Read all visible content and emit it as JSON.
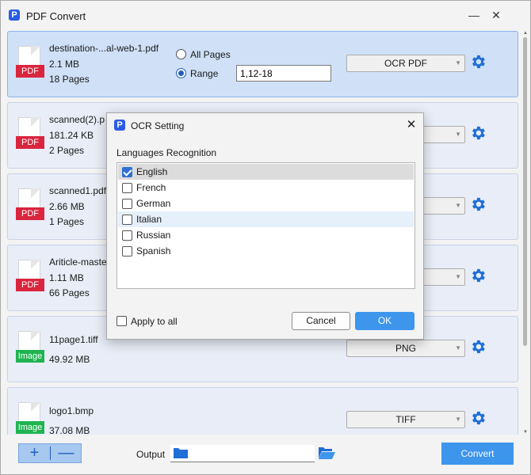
{
  "app": {
    "title": "PDF Convert",
    "logo_letter": "P",
    "minimize": "—",
    "close": "✕"
  },
  "colors": {
    "accent": "#3d95ec",
    "pdf_tag": "#d9253d",
    "image_tag": "#1fb451",
    "selected_card": "#cfe0f7",
    "gear": "#1f6fd6"
  },
  "files": [
    {
      "name": "destination-...al-web-1.pdf",
      "size": "2.1 MB",
      "pages": "18 Pages",
      "tag": "PDF",
      "format": "OCR PDF",
      "icon": "pdf-file-icon",
      "page_mode": {
        "all_label": "All Pages",
        "range_label": "Range",
        "range_value": "1,12-18",
        "selected": "Range"
      }
    },
    {
      "name": "scanned(2).p",
      "size": "181.24 KB",
      "pages": "2 Pages",
      "tag": "PDF",
      "format": "",
      "icon": "pdf-file-icon"
    },
    {
      "name": "scanned1.pdf",
      "size": "2.66 MB",
      "pages": "1 Pages",
      "tag": "PDF",
      "format": "",
      "icon": "pdf-file-icon"
    },
    {
      "name": "Ariticle-maste",
      "size": "1.11 MB",
      "pages": "66 Pages",
      "tag": "PDF",
      "format": "",
      "icon": "pdf-file-icon"
    },
    {
      "name": "11page1.tiff",
      "size": "49.92 MB",
      "pages": "",
      "tag": "Image",
      "format": "PNG",
      "icon": "image-file-icon"
    },
    {
      "name": "logo1.bmp",
      "size": "37.08 MB",
      "pages": "",
      "tag": "Image",
      "format": "TIFF",
      "icon": "image-file-icon"
    }
  ],
  "bottom": {
    "add": "+",
    "remove": "—",
    "output_label": "Output",
    "output_value": "",
    "convert_label": "Convert"
  },
  "dialog": {
    "title": "OCR Setting",
    "close": "✕",
    "section_label": "Languages Recognition",
    "languages": [
      {
        "label": "English",
        "checked": true
      },
      {
        "label": "French",
        "checked": false
      },
      {
        "label": "German",
        "checked": false
      },
      {
        "label": "Italian",
        "checked": false
      },
      {
        "label": "Russian",
        "checked": false
      },
      {
        "label": "Spanish",
        "checked": false
      }
    ],
    "apply_all_label": "Apply to all",
    "apply_all_checked": false,
    "cancel_label": "Cancel",
    "ok_label": "OK"
  }
}
